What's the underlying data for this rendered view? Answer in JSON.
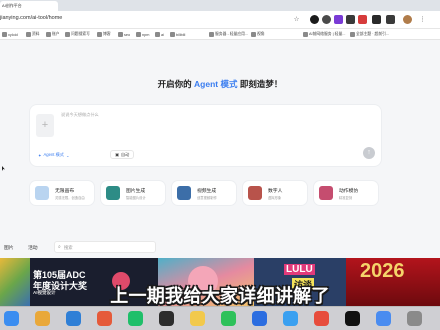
{
  "browser": {
    "tab_title": "AI创作平台",
    "url": "jianying.com/ai-tool/home",
    "bookmarks": [
      "xyloid",
      "资料",
      "账户",
      "问题搜索写",
      "博客",
      "seo",
      "npm",
      "ai",
      "bilibili",
      "服务器 - 轻量应用...",
      "视角",
      "AI前网络服务 | 轻量...",
      "全部主题 · 超前引..."
    ]
  },
  "main": {
    "heading_prefix": "开启你的",
    "heading_highlight": "Agent 模式",
    "heading_suffix": "即刻造梦！",
    "prompt_placeholder": "说说今天想做点什么",
    "attach_symbol": "+",
    "mode_label": "Agent 模式",
    "ratio_label": "自动",
    "send_symbol": "↑"
  },
  "features": [
    {
      "title": "无限画布",
      "subtitle": "灵感无限，创造自由",
      "color": "#b9d4f0"
    },
    {
      "title": "图片生成",
      "subtitle": "智能图片设计",
      "color": "#2d8c86"
    },
    {
      "title": "视频生成",
      "subtitle": "创意视频制作",
      "color": "#3c6ea8"
    },
    {
      "title": "数字人",
      "subtitle": "虚拟形象",
      "color": "#b8534b"
    },
    {
      "title": "动作模仿",
      "subtitle": "精准复刻",
      "color": "#c54d6f"
    }
  ],
  "lower": {
    "tab_left": "图片",
    "tab_right": "活动",
    "search_placeholder": "搜索"
  },
  "thumbnails": {
    "adc_line1": "第105届ADC",
    "adc_line2": "年度设计大奖",
    "adc_line3": "AI视觉设计",
    "lulu": "LULU",
    "lulu_sub": "访谈",
    "year": "2026"
  },
  "subtitle": "上一期我给大家详细讲解了",
  "dock": [
    "Finder",
    "Chrome",
    "VS Code",
    "Git",
    "PyCharm",
    "Terminal",
    "Notes",
    "WeChat",
    "QQ",
    "Mail",
    "Calendar",
    "TikTok",
    "Store",
    "Trash"
  ]
}
